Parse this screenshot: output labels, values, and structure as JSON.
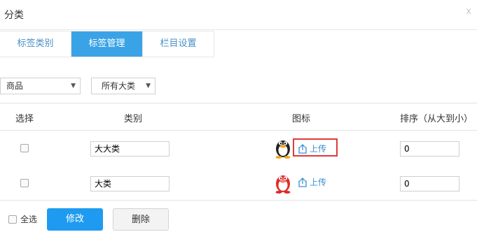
{
  "dialog": {
    "title": "分类",
    "close_label": "x"
  },
  "tabs": [
    {
      "label": "标签类别",
      "active": false
    },
    {
      "label": "标签管理",
      "active": true
    },
    {
      "label": "栏目设置",
      "active": false
    }
  ],
  "filters": {
    "product_select": {
      "value": "商品"
    },
    "category_select": {
      "value": "所有大类"
    }
  },
  "table": {
    "headers": {
      "select": "选择",
      "category": "类别",
      "icon": "图标",
      "order": "排序（从大到小）"
    },
    "rows": [
      {
        "checked": false,
        "category": "大大类",
        "icon": "qq-penguin-black-icon",
        "upload_label": "上传",
        "order": "0"
      },
      {
        "checked": false,
        "category": "大类",
        "icon": "qq-penguin-red-icon",
        "upload_label": "上传",
        "order": "0"
      }
    ]
  },
  "footer": {
    "select_all_label": "全选",
    "modify_label": "修改",
    "delete_label": "删除"
  },
  "colors": {
    "accent": "#3aa3e6",
    "primary_button": "#1e9bf0",
    "highlight": "#e03a3a",
    "link": "#3a8fd6"
  }
}
